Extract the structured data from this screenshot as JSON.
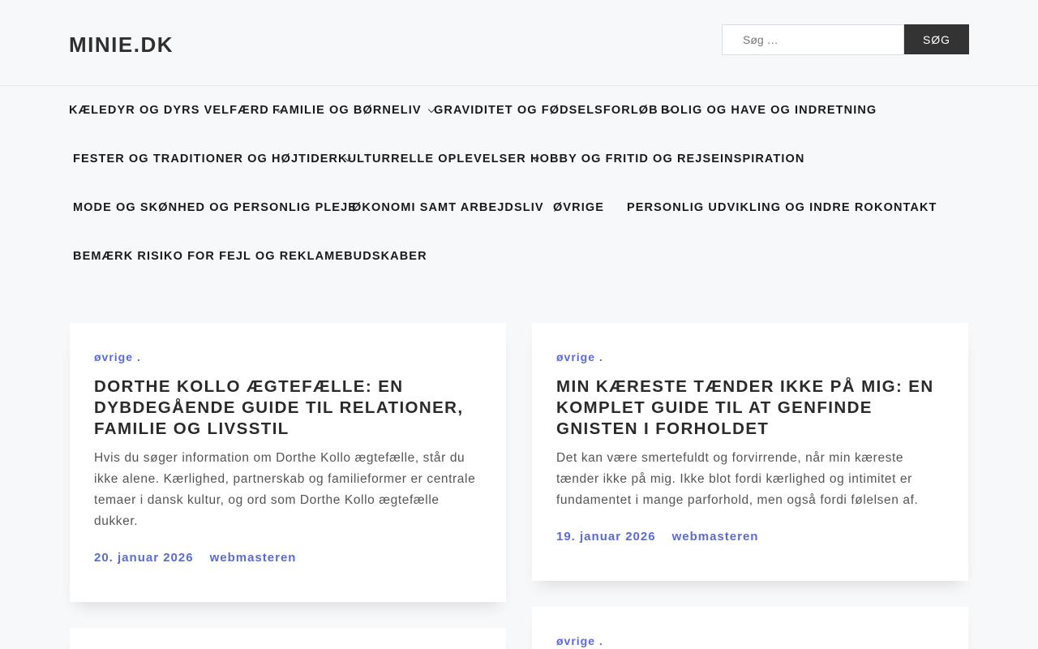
{
  "site": {
    "title": "MINIE.DK"
  },
  "search": {
    "placeholder": "Søg …",
    "button_label": "SØG"
  },
  "nav": {
    "items": [
      {
        "label": "KÆLEDYR OG DYRS VELFÆRD"
      },
      {
        "label": "FAMILIE OG BØRNELIV"
      },
      {
        "label": "GRAVIDITET OG FØDSELSFORLØB"
      },
      {
        "label": "BOLIG OG HAVE OG INDRETNING"
      },
      {
        "label": "FESTER OG TRADITIONER OG HØJTIDER"
      },
      {
        "label": "KULTURRELLE OPLEVELSER"
      },
      {
        "label": "HOBBY OG FRITID OG REJSEINSPIRATION"
      },
      {
        "label": "MODE OG SKØNHED OG PERSONLIG PLEJE"
      },
      {
        "label": "ØKONOMI SAMT ARBEJDSLIV"
      },
      {
        "label": "ØVRIGE"
      },
      {
        "label": "PERSONLIG UDVIKLING OG INDRE RO"
      },
      {
        "label": "KONTAKT"
      },
      {
        "label": "BEMÆRK RISIKO FOR FEJL OG REKLAMEBUDSKABER"
      }
    ]
  },
  "posts": [
    {
      "category": "øvrige .",
      "title": "DORTHE KOLLO ÆGTEFÆLLE: EN DYBDEGÅENDE GUIDE TIL RELATIONER, FAMILIE OG LIVSSTIL",
      "excerpt": "Hvis du søger information om Dorthe Kollo ægtefælle, står du ikke alene. Kærlighed, partnerskab og familieformer er centrale temaer i dansk kultur, og ord som Dorthe Kollo ægtefælle dukker.",
      "date": "20. januar 2026",
      "author": "webmasteren"
    },
    {
      "category": "øvrige .",
      "title": "MIN KÆRESTE TÆNDER IKKE PÅ MIG: EN KOMPLET GUIDE TIL AT GENFINDE GNISTEN I FORHOLDET",
      "excerpt": "Det kan være smertefuldt og forvirrende, når min kæreste tænder ikke på mig. Ikke blot fordi kærlighed og intimitet er fundamentet i mange parforhold, men også fordi følelsen af.",
      "date": "19. januar 2026",
      "author": "webmasteren"
    },
    {
      "category": "øvrige ."
    }
  ],
  "colors": {
    "accent": "#5b6bd5",
    "button_bg": "#333333",
    "page_bg": "#f7f8fa"
  }
}
